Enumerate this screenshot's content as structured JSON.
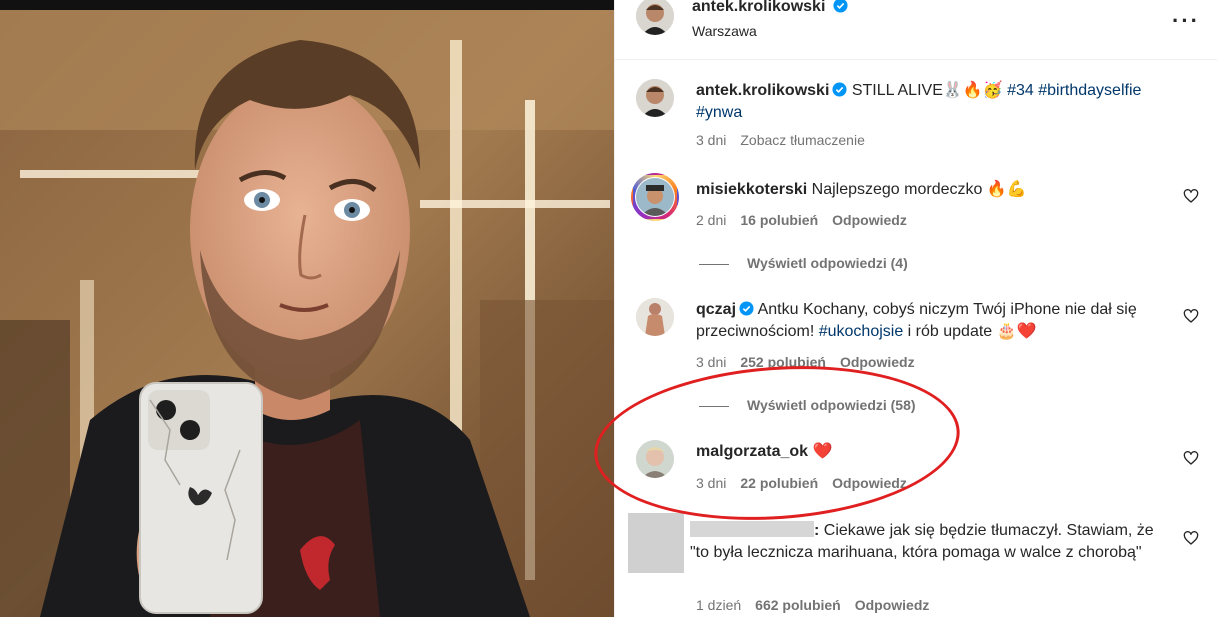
{
  "post": {
    "author": "antek.krolikowski",
    "location": "Warszawa"
  },
  "caption": {
    "author": "antek.krolikowski",
    "text": "STILL ALIVE🐰🔥🥳",
    "tags": [
      "#34",
      "#birthdayselfie",
      "#ynwa"
    ],
    "time": "3 dni",
    "translate": "Zobacz tłumaczenie"
  },
  "comments": [
    {
      "author": "misiekkoterski",
      "text": "Najlepszego mordeczko 🔥💪",
      "time": "2 dni",
      "likes": "16 polubień",
      "reply": "Odpowiedz",
      "view_replies": "Wyświetl odpowiedzi (4)"
    },
    {
      "author": "qczaj",
      "text_before": "Antku Kochany, cobyś niczym Twój iPhone nie dał się przeciwnościom!",
      "tag": "#ukochojsie",
      "text_after": "i rób update 🎂❤️",
      "time": "3 dni",
      "likes": "252 polubień",
      "reply": "Odpowiedz",
      "view_replies": "Wyświetl odpowiedzi (58)"
    },
    {
      "author": "malgorzata_ok",
      "text": "❤️",
      "time": "3 dni",
      "likes": "22 polubień",
      "reply": "Odpowiedz"
    },
    {
      "author_suffix": ":",
      "text": "Ciekawe jak się będzie tłumaczył. Stawiam, że \"to była lecznicza marihuana, która pomaga w walce z chorobą\"",
      "time": "1 dzień",
      "likes": "662 polubień",
      "reply": "Odpowiedz"
    }
  ],
  "colors": {
    "verified": "#0095f6",
    "hashtag": "#00376b",
    "annotation_circle": "#e02020"
  }
}
